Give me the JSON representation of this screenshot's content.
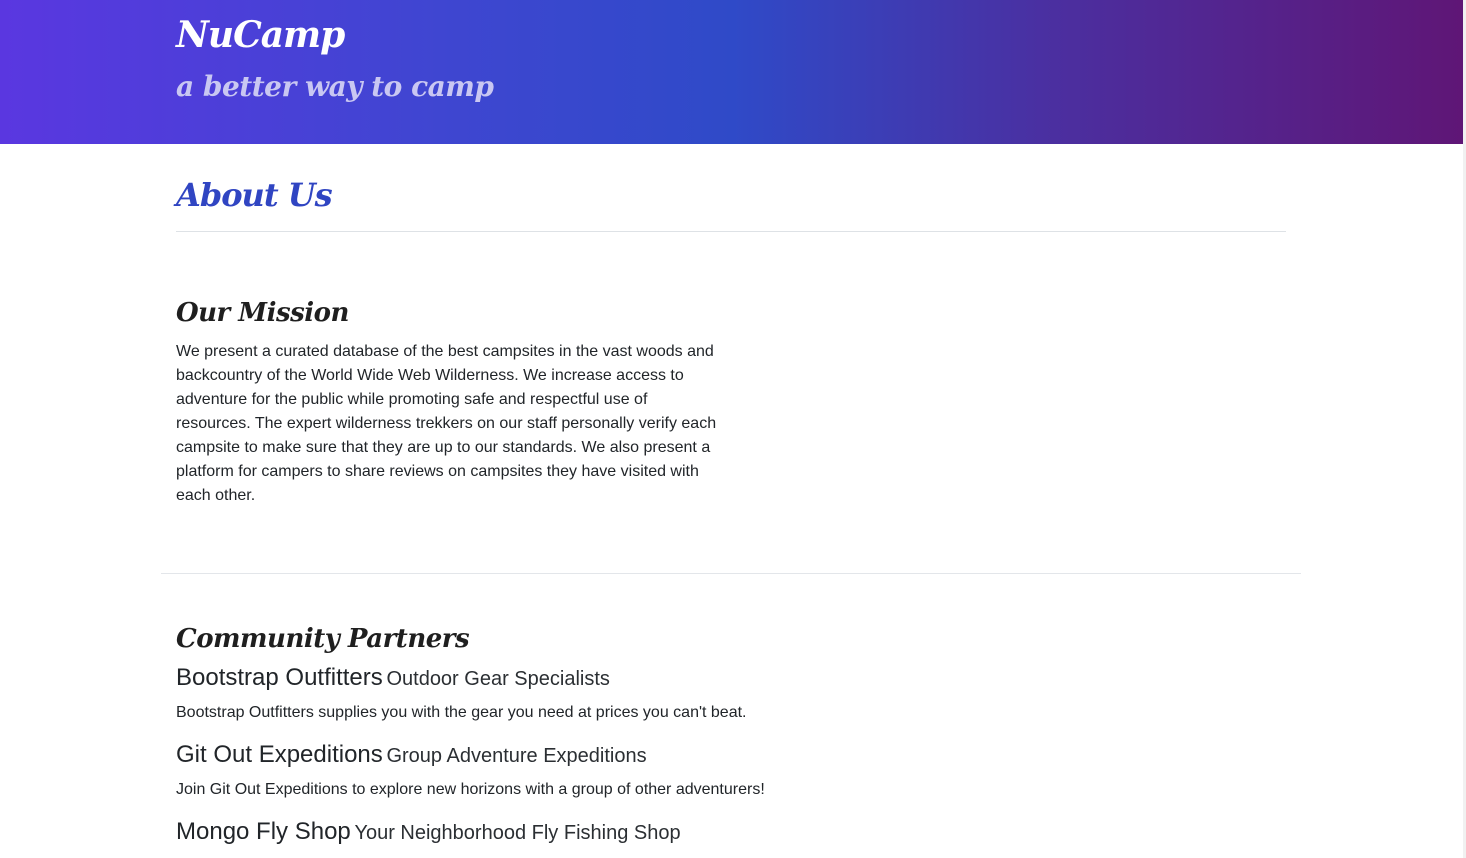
{
  "header": {
    "brand": "NuCamp",
    "tagline": "a better way to camp"
  },
  "main": {
    "title": "About Us",
    "mission": {
      "heading": "Our Mission",
      "text": "We present a curated database of the best campsites in the vast woods and backcountry of the World Wide Web Wilderness. We increase access to adventure for the public while promoting safe and respectful use of resources. The expert wilderness trekkers on our staff personally verify each campsite to make sure that they are up to our standards. We also present a platform for campers to share reviews on campsites they have visited with each other."
    },
    "partners": {
      "heading": "Community Partners",
      "items": [
        {
          "name": "Bootstrap Outfitters",
          "subtitle": "Outdoor Gear Specialists",
          "description": "Bootstrap Outfitters supplies you with the gear you need at prices you can't beat."
        },
        {
          "name": "Git Out Expeditions",
          "subtitle": "Group Adventure Expeditions",
          "description": "Join Git Out Expeditions to explore new horizons with a group of other adventurers!"
        },
        {
          "name": "Mongo Fly Shop",
          "subtitle": "Your Neighborhood Fly Fishing Shop",
          "description": ""
        }
      ]
    }
  },
  "colors": {
    "heading_blue": "#3045c2",
    "jumbotron_start": "#5a37e0",
    "jumbotron_end": "#5f1676"
  }
}
